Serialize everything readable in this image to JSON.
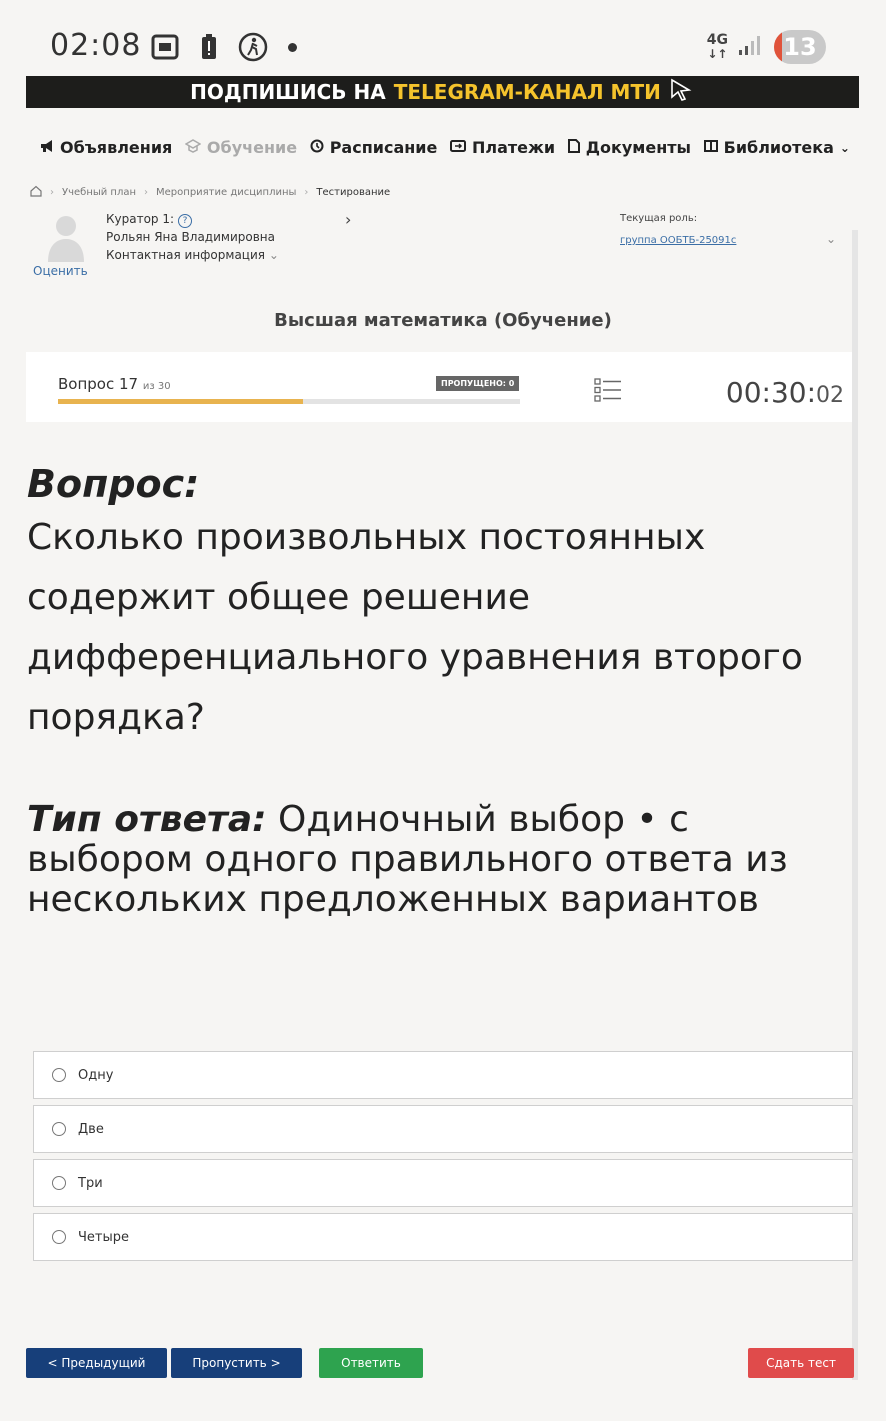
{
  "status_bar": {
    "time": "02:08",
    "network": "4G",
    "battery": "13"
  },
  "banner": {
    "prefix": "ПОДПИШИСЬ НА",
    "highlight": "TELEGRAM-КАНАЛ МТИ"
  },
  "nav": {
    "items": [
      {
        "label": "Объявления",
        "icon": "megaphone-icon"
      },
      {
        "label": "Обучение",
        "icon": "graduation-cap-icon"
      },
      {
        "label": "Расписание",
        "icon": "clock-icon"
      },
      {
        "label": "Платежи",
        "icon": "payment-icon"
      },
      {
        "label": "Документы",
        "icon": "document-icon"
      },
      {
        "label": "Библиотека",
        "icon": "book-icon"
      }
    ]
  },
  "breadcrumb": {
    "items": [
      "Учебный план",
      "Мероприятие дисциплины",
      "Тестирование"
    ]
  },
  "curator": {
    "title": "Куратор 1:",
    "name": "Рольян Яна Владимировна",
    "contact": "Контактная информация",
    "rate": "Оценить"
  },
  "role": {
    "label": "Текущая роль:",
    "value": "группа ООБТБ-25091с"
  },
  "course_title": "Высшая математика (Обучение)",
  "progress": {
    "question_label": "Вопрос 17",
    "of_label": "из 30",
    "skipped": "ПРОПУЩЕНО: 0",
    "fraction": 0.53,
    "timer_main": "00:30:",
    "timer_sec": "02"
  },
  "question": {
    "heading": "Вопрос:",
    "text": "Сколько произвольных постоянных содержит общее решение дифференциального уравнения второго порядка?",
    "answer_type_label": "Тип ответа:",
    "answer_type_text": "Одиночный выбор • с выбором одного правильного ответа из нескольких предложенных вариантов"
  },
  "options": [
    "Одну",
    "Две",
    "Три",
    "Четыре"
  ],
  "buttons": {
    "prev": "< Предыдущий",
    "skip": "Пропустить >",
    "answer": "Ответить",
    "submit": "Сдать тест"
  },
  "colors": {
    "primary": "#173f7a",
    "answer": "#2ea34f",
    "submit": "#e04b4b",
    "progress": "#e8b34f",
    "link": "#3b6ea6"
  }
}
